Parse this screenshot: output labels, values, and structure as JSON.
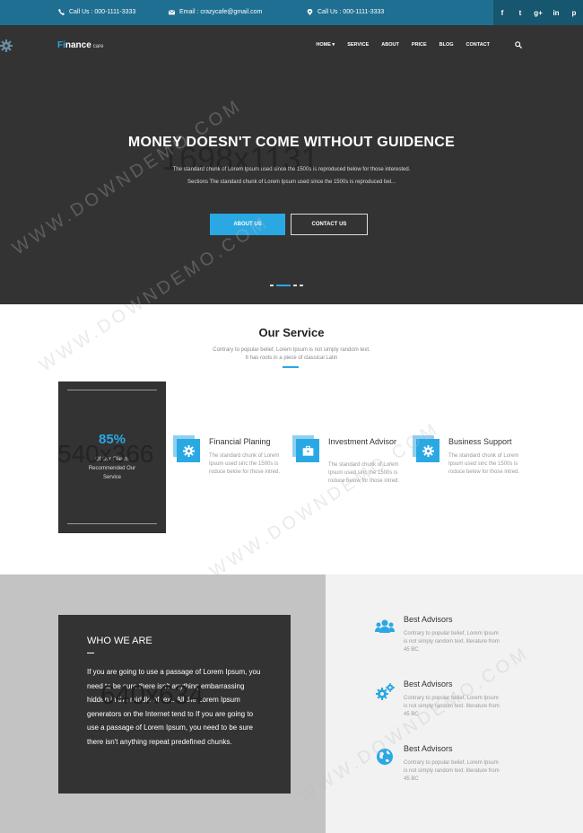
{
  "topbar": {
    "phone1": "Call Us : 000-1111-3333",
    "email": "Email : crazycafe@gmail.com",
    "phone2": "Call Us : 000-1111-3333",
    "social": [
      {
        "icon": "facebook-icon",
        "glyph": "f"
      },
      {
        "icon": "twitter-icon",
        "glyph": "t"
      },
      {
        "icon": "google-plus-icon",
        "glyph": "g+"
      },
      {
        "icon": "linkedin-icon",
        "glyph": "in"
      },
      {
        "icon": "pinterest-icon",
        "glyph": "p"
      }
    ]
  },
  "header": {
    "logo_first": "Fi",
    "logo_rest": "nance",
    "logo_small": "care",
    "nav": [
      "HOME ▾",
      "SERVICE",
      "ABOUT",
      "PRICE",
      "BLOG",
      "CONTACT"
    ]
  },
  "hero": {
    "title": "MONEY DOESN'T COME WITHOUT GUIDENCE",
    "line1": "The standard chunk of Lorem Ipsum used since the 1500s is reproduced below for those interested.",
    "line2": "Sections The standard chunk of Lorem Ipsum used since the 1500s is reproduced bel...",
    "btn_about": "ABOUT US",
    "btn_contact": "CONTACT US",
    "placeholder_size": "1698x1131",
    "slides": 4,
    "active_slide": 1
  },
  "service": {
    "title": "Our Service",
    "sub1": "Contrary to popular belief, Lorem Ipsum is not simply random text.",
    "sub2": "It has roots in a piece of classical Latin",
    "clients_pct": "85%",
    "clients_caption": "Of Our Clients Recommended Our Service",
    "placeholder_size": "540x366",
    "features": [
      {
        "title": "Financial Planing",
        "desc": "The standard chunk of Lorem Ipsum used sinc the 1500s is roduce below for those intred.",
        "icon": "gear-icon"
      },
      {
        "title": "Investment Advisor",
        "desc": "The standard chunk of Lorem Ipsum used sinc the 1500s is roduce below for those intred.",
        "icon": "briefcase-icon"
      },
      {
        "title": "Business Support",
        "desc": "The standard chunk of Lorem Ipsum used sinc the 1500s is roduce below for those intred.",
        "icon": "gear-icon"
      }
    ]
  },
  "about": {
    "title": "WHO WE ARE",
    "text": "If you are going to use a passage of Lorem Ipsum, you need to be sure there isn't anything embarrassing hidden in the middle of text. All the Lorem Ipsum generators on the Internet tend to If you are going to use a passage of Lorem Ipsum, you need to be sure there isn't anything repeat predefined chunks.",
    "placeholder_size": "640x634",
    "advisors": [
      {
        "title": "Best Advisors",
        "desc": "Contrary to popular belief, Lorem Ipsum is not simply random text. literature from 45 BC",
        "icon": "users-icon"
      },
      {
        "title": "Best Advisors",
        "desc": "Contrary to popular belief, Lorem Ipsum is not simply random text. literature from 45 BC",
        "icon": "gears-icon"
      },
      {
        "title": "Best Advisors",
        "desc": "Contrary to popular belief, Lorem Ipsum is not simply random text. literature from 45 BC",
        "icon": "globe-icon"
      }
    ]
  },
  "watermark": "WWW.DOWNDEMO.COM",
  "colors": {
    "accent": "#2aa8e4",
    "topbar": "#1f6f92",
    "dark": "#333333"
  }
}
